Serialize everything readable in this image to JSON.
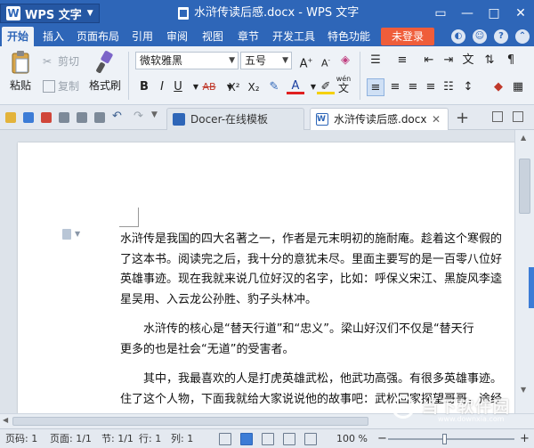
{
  "titlebar": {
    "app_name": "WPS 文字",
    "doc_title": "水浒传读后感.docx - WPS 文字"
  },
  "menu": {
    "tabs": [
      "开始",
      "插入",
      "页面布局",
      "引用",
      "审阅",
      "视图",
      "章节",
      "开发工具",
      "特色功能"
    ],
    "active": "开始",
    "login": "未登录"
  },
  "ribbon": {
    "paste": "粘贴",
    "cut": "剪切",
    "copy": "复制",
    "format_painter": "格式刷",
    "font_name": "微软雅黑",
    "font_size": "五号",
    "bold": "B",
    "italic": "I",
    "underline": "U",
    "strikethrough": "AB",
    "superscript": "X²",
    "subscript": "X₂",
    "font_color": "A",
    "phonetic": "wén"
  },
  "tabs": {
    "docer": "Docer-在线模板",
    "active_doc": "水浒传读后感.docx"
  },
  "document": {
    "paragraphs": [
      "水浒传是我国的四大名著之一，作者是元末明初的施耐庵。趁着这个寒假的",
      "了这本书。阅读完之后，我十分的意犹未尽。里面主要写的是一百零八位好",
      "英雄事迹。现在我就来说几位好汉的名字，比如：呼保义宋江、黑旋风李逵",
      "星吴用、入云龙公孙胜、豹子头林冲。",
      "水浒传的核心是“替天行道”和“忠义”。梁山好汉们不仅是“替天行",
      "更多的也是社会“无道”的受害者。",
      "其中，我最喜欢的人是打虎英雄武松，他武功高强。有很多英雄事迹。",
      "住了这个人物，下面我就给大家说说他的故事吧：武松回家探望哥哥，途经"
    ]
  },
  "statusbar": {
    "page_no": "页码: 1",
    "pages": "页面: 1/1",
    "section": "节: 1/1",
    "row": "行: 1",
    "col": "列: 1",
    "zoom": "100 %",
    "zoom_fraction": 0.45
  },
  "watermark": {
    "text": "当下软件园",
    "sub": "www.downxia.com"
  }
}
